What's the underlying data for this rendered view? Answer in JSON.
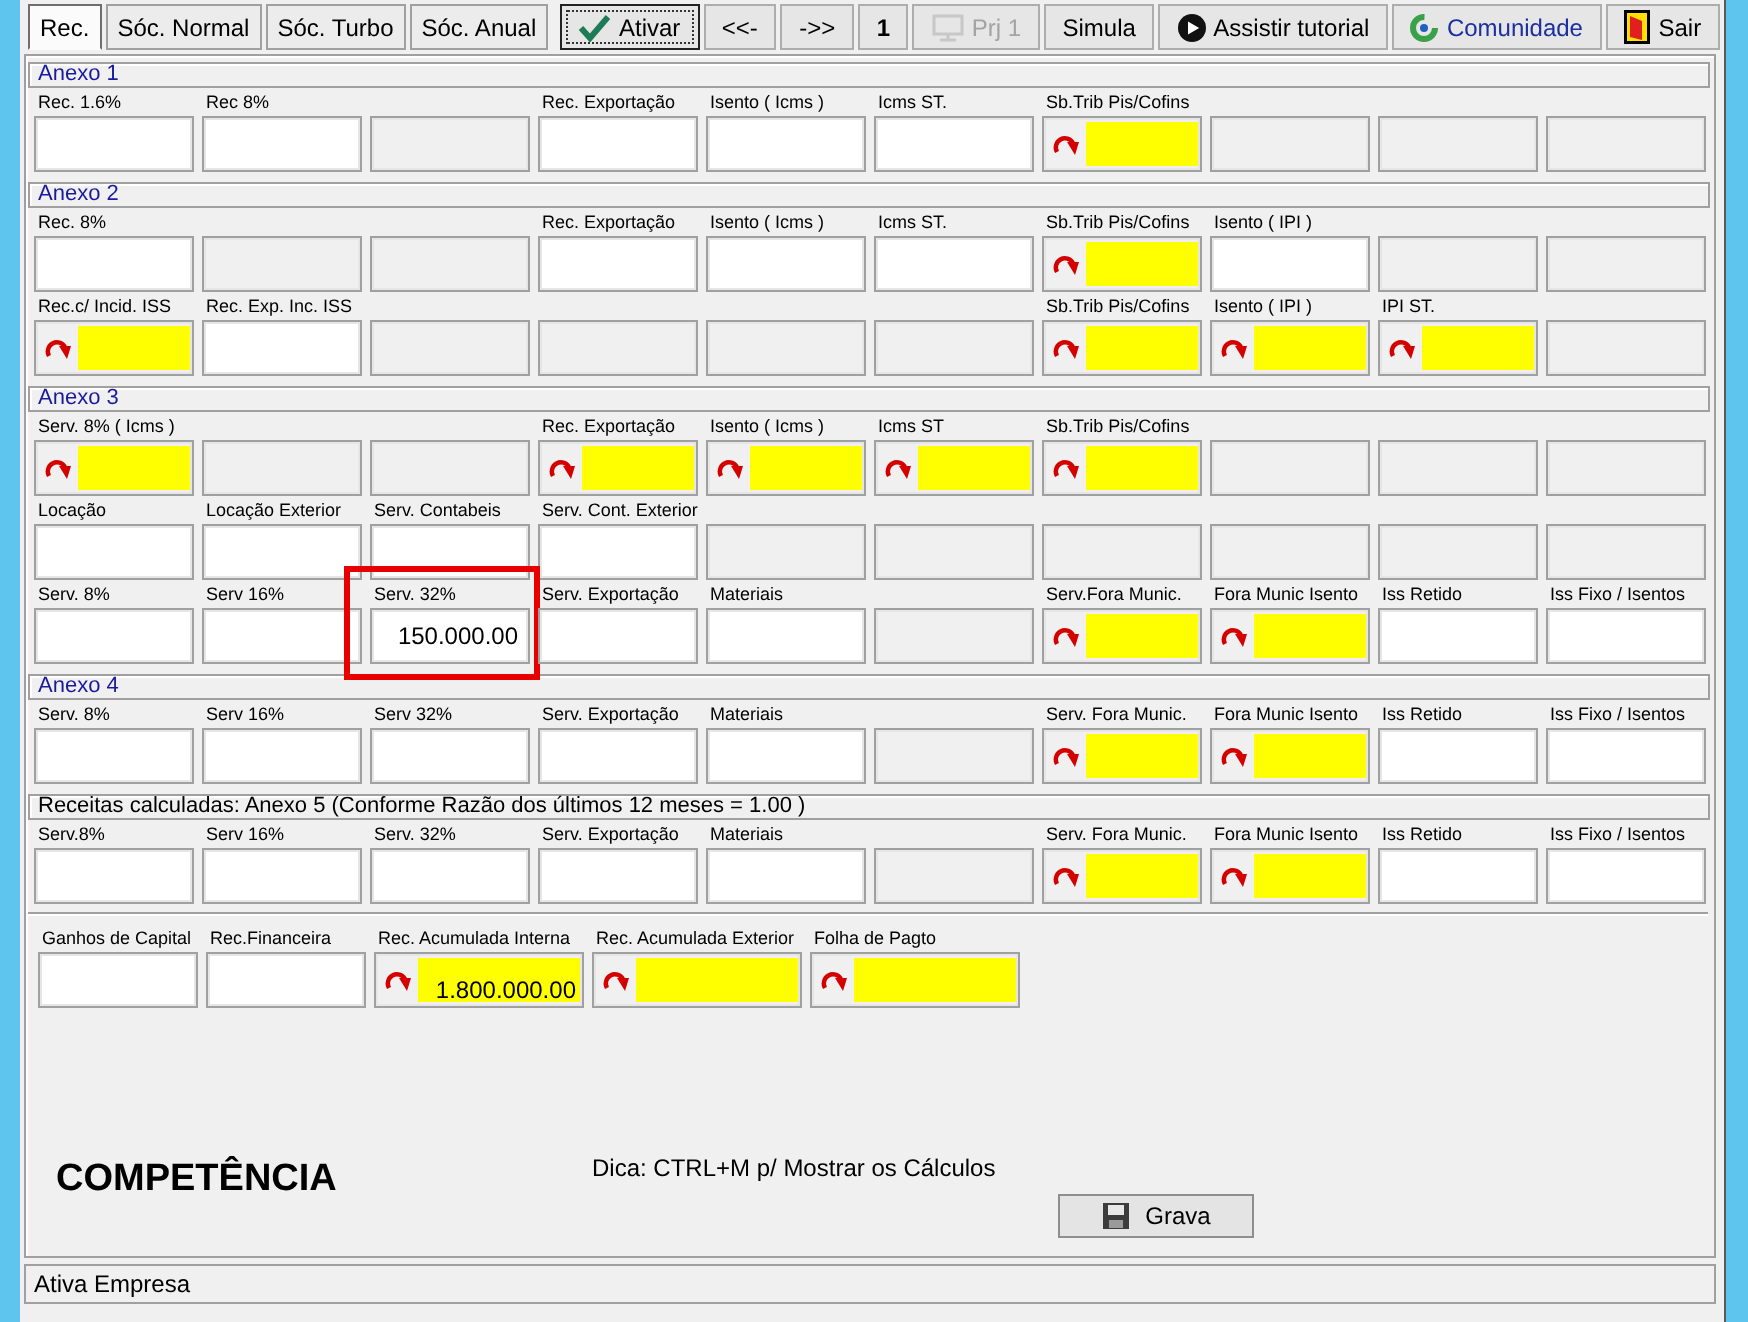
{
  "toolbar": {
    "tabs": [
      {
        "label": "Rec.",
        "selected": true
      },
      {
        "label": "Sóc. Normal",
        "selected": false
      },
      {
        "label": "Sóc. Turbo",
        "selected": false
      },
      {
        "label": "Sóc. Anual",
        "selected": false
      }
    ],
    "buttons": [
      {
        "label": "Ativar",
        "kind": "check",
        "focused": true,
        "disabled": false
      },
      {
        "label": "<<-",
        "kind": "plain",
        "focused": false,
        "disabled": false
      },
      {
        "label": "->>",
        "kind": "plain",
        "focused": false,
        "disabled": false
      },
      {
        "label": "1",
        "kind": "counter",
        "focused": false,
        "disabled": false
      },
      {
        "label": "Prj 1",
        "kind": "monitor",
        "focused": false,
        "disabled": true
      },
      {
        "label": "Simula",
        "kind": "plain",
        "focused": false,
        "disabled": false
      },
      {
        "label": "Assistir tutorial",
        "kind": "play",
        "focused": false,
        "disabled": false
      },
      {
        "label": "Comunidade",
        "kind": "community",
        "focused": false,
        "disabled": false
      },
      {
        "label": "Sair",
        "kind": "exit",
        "focused": false,
        "disabled": false
      }
    ]
  },
  "sections": [
    {
      "title": "Anexo 1",
      "kind": "anexo",
      "rows": [
        [
          {
            "kind": "text",
            "label": "Rec. 1.6%"
          },
          {
            "kind": "text",
            "label": "Rec 8%"
          },
          {
            "kind": "blank"
          },
          {
            "kind": "text",
            "label": "Rec. Exportação"
          },
          {
            "kind": "text",
            "label": "Isento ( Icms )"
          },
          {
            "kind": "text",
            "label": "Icms ST."
          },
          {
            "kind": "computed",
            "label": "Sb.Trib Pis/Cofins"
          },
          {
            "kind": "blank"
          },
          {
            "kind": "blank"
          },
          {
            "kind": "blank"
          }
        ]
      ]
    },
    {
      "title": "Anexo 2",
      "kind": "anexo",
      "rows": [
        [
          {
            "kind": "text",
            "label": "Rec. 8%"
          },
          {
            "kind": "blank"
          },
          {
            "kind": "blank"
          },
          {
            "kind": "text",
            "label": "Rec. Exportação"
          },
          {
            "kind": "text",
            "label": "Isento ( Icms )"
          },
          {
            "kind": "text",
            "label": "Icms ST."
          },
          {
            "kind": "computed",
            "label": "Sb.Trib Pis/Cofins"
          },
          {
            "kind": "text",
            "label": "Isento ( IPI )"
          },
          {
            "kind": "blank"
          },
          {
            "kind": "blank"
          }
        ],
        [
          {
            "kind": "computed",
            "label": "Rec.c/ Incid. ISS"
          },
          {
            "kind": "text",
            "label": "Rec. Exp. Inc. ISS"
          },
          {
            "kind": "blank"
          },
          {
            "kind": "blank"
          },
          {
            "kind": "blank"
          },
          {
            "kind": "blank"
          },
          {
            "kind": "computed",
            "label": "Sb.Trib Pis/Cofins"
          },
          {
            "kind": "computed",
            "label": "Isento ( IPI )"
          },
          {
            "kind": "computed",
            "label": "IPI ST."
          },
          {
            "kind": "blank"
          }
        ]
      ]
    },
    {
      "title": "Anexo 3",
      "kind": "anexo",
      "rows": [
        [
          {
            "kind": "computed",
            "label": "Serv. 8% ( Icms )"
          },
          {
            "kind": "blank"
          },
          {
            "kind": "blank"
          },
          {
            "kind": "computed",
            "label": "Rec. Exportação"
          },
          {
            "kind": "computed",
            "label": "Isento ( Icms )"
          },
          {
            "kind": "computed",
            "label": "Icms ST"
          },
          {
            "kind": "computed",
            "label": "Sb.Trib Pis/Cofins"
          },
          {
            "kind": "blank"
          },
          {
            "kind": "blank"
          },
          {
            "kind": "blank"
          }
        ],
        [
          {
            "kind": "text",
            "label": "Locação"
          },
          {
            "kind": "text",
            "label": "Locação Exterior"
          },
          {
            "kind": "text",
            "label": "Serv. Contabeis"
          },
          {
            "kind": "text",
            "label": "Serv. Cont. Exterior"
          },
          {
            "kind": "blank"
          },
          {
            "kind": "blank"
          },
          {
            "kind": "blank"
          },
          {
            "kind": "blank"
          },
          {
            "kind": "blank"
          },
          {
            "kind": "blank"
          }
        ],
        [
          {
            "kind": "text",
            "label": "Serv. 8%"
          },
          {
            "kind": "text",
            "label": "Serv 16%"
          },
          {
            "kind": "text",
            "label": "Serv. 32%",
            "value": "150.000.00",
            "highlighted": true
          },
          {
            "kind": "text",
            "label": "Serv. Exportação"
          },
          {
            "kind": "text",
            "label": "Materiais"
          },
          {
            "kind": "blank"
          },
          {
            "kind": "computed",
            "label": "Serv.Fora Munic."
          },
          {
            "kind": "computed",
            "label": "Fora Munic Isento"
          },
          {
            "kind": "text",
            "label": "Iss Retido"
          },
          {
            "kind": "text",
            "label": "Iss Fixo / Isentos"
          }
        ]
      ]
    },
    {
      "title": "Anexo 4",
      "kind": "anexo",
      "rows": [
        [
          {
            "kind": "text",
            "label": "Serv. 8%"
          },
          {
            "kind": "text",
            "label": "Serv 16%"
          },
          {
            "kind": "text",
            "label": "Serv 32%"
          },
          {
            "kind": "text",
            "label": "Serv. Exportação"
          },
          {
            "kind": "text",
            "label": "Materiais"
          },
          {
            "kind": "blank"
          },
          {
            "kind": "computed",
            "label": "Serv. Fora Munic."
          },
          {
            "kind": "computed",
            "label": "Fora Munic Isento"
          },
          {
            "kind": "text",
            "label": "Iss Retido"
          },
          {
            "kind": "text",
            "label": "Iss Fixo / Isentos"
          }
        ]
      ]
    },
    {
      "title": "Receitas calculadas: Anexo 5 (Conforme Razão dos últimos 12 meses = 1.00 )",
      "kind": "calculated",
      "rows": [
        [
          {
            "kind": "text",
            "label": "Serv.8%"
          },
          {
            "kind": "text",
            "label": "Serv 16%"
          },
          {
            "kind": "text",
            "label": "Serv. 32%"
          },
          {
            "kind": "text",
            "label": "Serv. Exportação"
          },
          {
            "kind": "text",
            "label": "Materiais"
          },
          {
            "kind": "blank"
          },
          {
            "kind": "computed",
            "label": "Serv. Fora Munic."
          },
          {
            "kind": "computed",
            "label": "Fora Munic Isento"
          },
          {
            "kind": "text",
            "label": "Iss Retido"
          },
          {
            "kind": "text",
            "label": "Iss Fixo / Isentos"
          }
        ]
      ]
    }
  ],
  "extra_fields": [
    {
      "kind": "text",
      "label": "Ganhos de Capital"
    },
    {
      "kind": "text",
      "label": "Rec.Financeira"
    },
    {
      "kind": "computed",
      "label": "Rec. Acumulada Interna",
      "value": "1.800.000.00"
    },
    {
      "kind": "computed",
      "label": "Rec. Acumulada Exterior"
    },
    {
      "kind": "computed",
      "label": "Folha de Pagto"
    }
  ],
  "competence_title": "COMPETÊNCIA",
  "hint": "Dica: CTRL+M p/ Mostrar os Cálculos",
  "save_button": {
    "label": "Grava"
  },
  "status_bar": "Ativa Empresa"
}
